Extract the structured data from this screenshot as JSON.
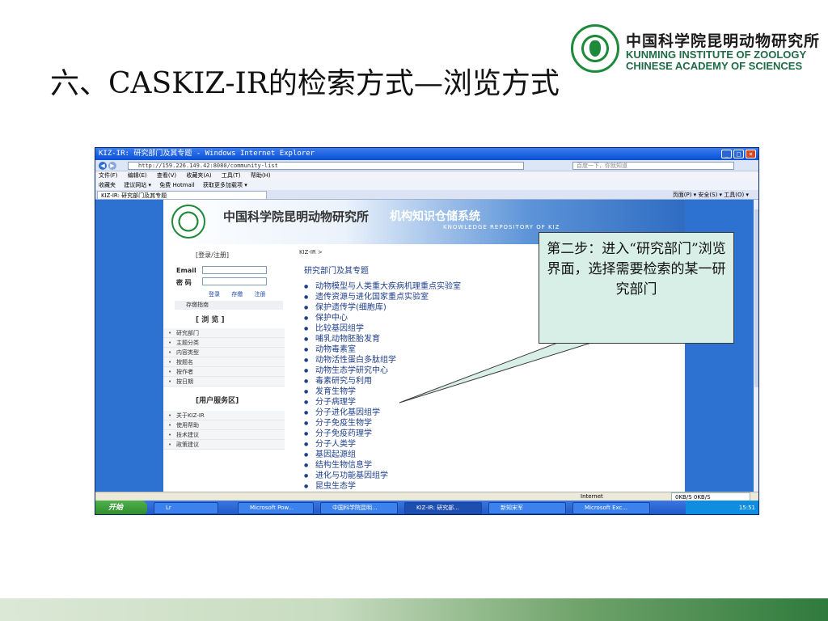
{
  "slide": {
    "title": "六、CASKIZ-IR的检索方式—浏览方式",
    "logo": {
      "cn": "中国科学院昆明动物研究所",
      "en_line1": "KUNMING INSTITUTE OF ZOOLOGY",
      "en_line2": "CHINESE ACADEMY OF SCIENCES"
    },
    "callout_text": "第二步：进入“研究部门”浏览界面，选择需要检索的某一研究部门"
  },
  "browser": {
    "window_title": "KIZ-IR: 研究部门及其专题 - Windows Internet Explorer",
    "url": "http://159.226.149.42:8080/community-list",
    "search_placeholder": "百度一下，你就知道",
    "menu": [
      "文件(F)",
      "编辑(E)",
      "查看(V)",
      "收藏夹(A)",
      "工具(T)",
      "帮助(H)"
    ],
    "favorites": [
      "收藏夹",
      "建议网站 ▾",
      "免费 Hotmail",
      "获取更多加载项 ▾"
    ],
    "tab_label": "KIZ-IR: 研究部门及其专题",
    "commands": "页面(P) ▾  安全(S) ▾  工具(O) ▾",
    "status_zone": "Internet",
    "net_meter": "0KB/S   0KB/S"
  },
  "site": {
    "banner_cn": "中国科学院昆明动物研究所",
    "banner_system": "机构知识仓储系统",
    "banner_en": "KNOWLEDGE REPOSITORY OF KIZ",
    "login_title": "[登录/注册]",
    "email_label": "Email",
    "password_label": "密 码",
    "login_links": [
      "登录",
      "存缴",
      "注册"
    ],
    "storage_guide": "存缴指南",
    "browse_title": "[ 浏 览 ]",
    "browse_items": [
      "研究部门",
      "主题分类",
      "内容类型",
      "按题名",
      "按作者",
      "按日期"
    ],
    "service_title": "[用户服务区]",
    "service_items": [
      "关于KIZ-IR",
      "使用帮助",
      "技术建议",
      "政策建议"
    ],
    "breadcrumb": "KIZ-IR >",
    "dept_heading": "研究部门及其专题",
    "departments": [
      "动物模型与人类重大疾病机理重点实验室",
      "遗传资源与进化国家重点实验室",
      "保护遗传学(细胞库)",
      "保护中心",
      "比较基因组学",
      "哺乳动物胚胎发育",
      "动物毒素室",
      "动物活性蛋白多肽组学",
      "动物生态学研究中心",
      "毒素研究与利用",
      "发育生物学",
      "分子病理学",
      "分子进化基因组学",
      "分子免疫生物学",
      "分子免疫药理学",
      "分子人类学",
      "基因起源组",
      "结构生物信息学",
      "进化与功能基因组学",
      "昆虫生态学"
    ]
  },
  "taskbar": {
    "start": "开始",
    "items": [
      "Lr",
      "Microsoft Pow...",
      "中国科学院昆明...",
      "KIZ-IR: 研究部...",
      "新知宋军",
      "Microsoft Exc..."
    ],
    "clock": "15:51"
  }
}
